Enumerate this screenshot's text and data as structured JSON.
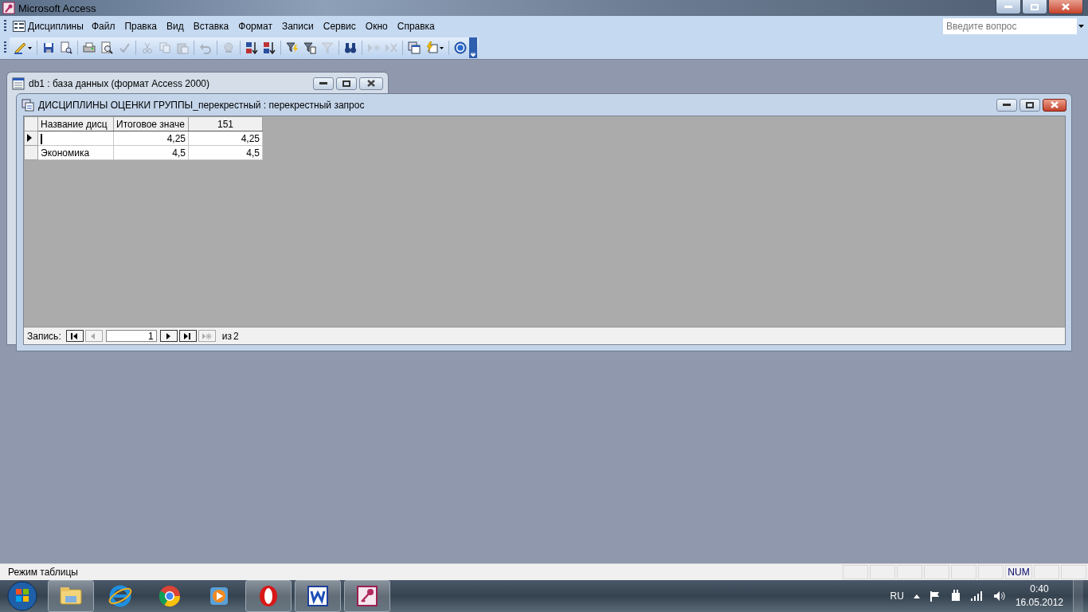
{
  "app_window": {
    "title": "Microsoft Access"
  },
  "menu_bar": {
    "title": "Дисциплины",
    "items": [
      "Файл",
      "Правка",
      "Вид",
      "Вставка",
      "Формат",
      "Записи",
      "Сервис",
      "Окно",
      "Справка"
    ]
  },
  "help_search": {
    "placeholder": "Введите вопрос"
  },
  "toolbar": [
    {
      "kind": "view",
      "disabled": false
    },
    {
      "kind": "separator"
    },
    {
      "kind": "save",
      "disabled": false
    },
    {
      "kind": "file-search",
      "disabled": false
    },
    {
      "kind": "separator"
    },
    {
      "kind": "print",
      "disabled": false
    },
    {
      "kind": "preview",
      "disabled": false
    },
    {
      "kind": "spelling",
      "disabled": true
    },
    {
      "kind": "separator"
    },
    {
      "kind": "cut",
      "disabled": true
    },
    {
      "kind": "copy",
      "disabled": true
    },
    {
      "kind": "paste",
      "disabled": true
    },
    {
      "kind": "separator"
    },
    {
      "kind": "undo",
      "disabled": true
    },
    {
      "kind": "separator"
    },
    {
      "kind": "hyperlink",
      "disabled": true
    },
    {
      "kind": "separator"
    },
    {
      "kind": "sort-asc",
      "disabled": false
    },
    {
      "kind": "sort-desc",
      "disabled": false
    },
    {
      "kind": "separator"
    },
    {
      "kind": "filter-selection",
      "disabled": false
    },
    {
      "kind": "filter-form",
      "disabled": false
    },
    {
      "kind": "filter-apply",
      "disabled": true
    },
    {
      "kind": "separator"
    },
    {
      "kind": "find",
      "disabled": false
    },
    {
      "kind": "separator"
    },
    {
      "kind": "new-record",
      "disabled": true
    },
    {
      "kind": "delete-record",
      "disabled": true
    },
    {
      "kind": "separator"
    },
    {
      "kind": "database-window",
      "disabled": false
    },
    {
      "kind": "new-object",
      "disabled": false
    },
    {
      "kind": "separator"
    },
    {
      "kind": "help",
      "disabled": false
    }
  ],
  "database_window": {
    "title": "db1 : база данных (формат Access 2000)",
    "active": false
  },
  "query_window": {
    "title": "ДИСЦИПЛИНЫ ОЦЕНКИ ГРУППЫ_перекрестный : перекрестный запрос",
    "active": true,
    "datasheet": {
      "columns": [
        "Название дисц",
        "Итоговое значе",
        "151"
      ],
      "rows": [
        {
          "current": true,
          "cells": [
            null,
            "4,25",
            "4,25"
          ]
        },
        {
          "current": false,
          "cells": [
            "Экономика",
            "4,5",
            "4,5"
          ]
        }
      ]
    },
    "navigation": {
      "label": "Запись:",
      "buttons": [
        {
          "kind": "first",
          "disabled": false
        },
        {
          "kind": "prev",
          "disabled": true
        },
        {
          "kind": "field"
        },
        {
          "kind": "next",
          "disabled": false
        },
        {
          "kind": "last",
          "disabled": false
        },
        {
          "kind": "new",
          "disabled": true
        }
      ],
      "record": "1",
      "of_label": "из",
      "total": "2"
    }
  },
  "status_bar": {
    "text": "Режим таблицы",
    "indicator": "NUM"
  },
  "taskbar": {
    "apps": [
      {
        "kind": "explorer",
        "running": true
      },
      {
        "kind": "ie",
        "running": false
      },
      {
        "kind": "chrome",
        "running": false
      },
      {
        "kind": "media",
        "running": false
      },
      {
        "kind": "opera",
        "running": true
      },
      {
        "kind": "word",
        "running": true
      },
      {
        "kind": "access",
        "running": true
      }
    ],
    "language": "RU",
    "time": "0:40",
    "date": "16.05.2012"
  }
}
